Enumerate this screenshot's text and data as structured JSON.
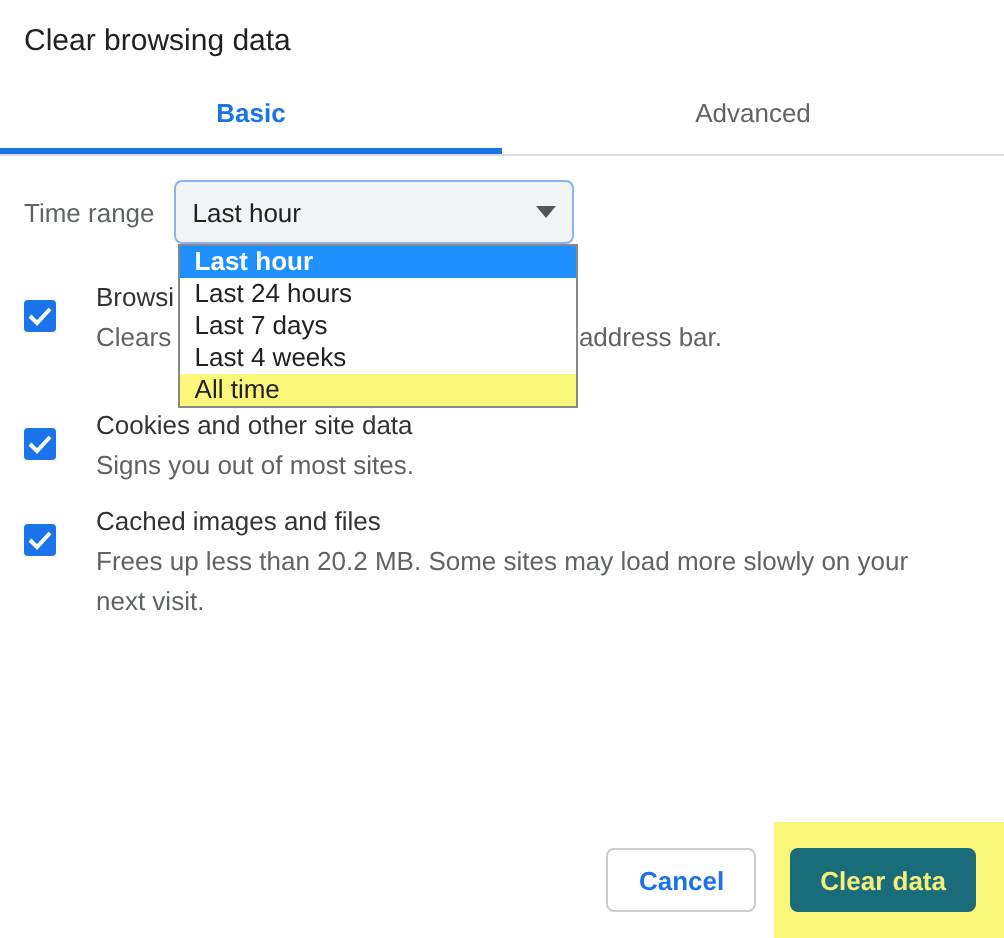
{
  "dialog": {
    "title": "Clear browsing data"
  },
  "tabs": [
    {
      "label": "Basic",
      "selected": true
    },
    {
      "label": "Advanced",
      "selected": false
    }
  ],
  "time_range": {
    "label": "Time range",
    "value": "Last hour",
    "expanded": true,
    "options": [
      {
        "label": "Last hour",
        "selected": true,
        "highlighted": false
      },
      {
        "label": "Last 24 hours",
        "selected": false,
        "highlighted": false
      },
      {
        "label": "Last 7 days",
        "selected": false,
        "highlighted": false
      },
      {
        "label": "Last 4 weeks",
        "selected": false,
        "highlighted": false
      },
      {
        "label": "All time",
        "selected": false,
        "highlighted": true
      }
    ]
  },
  "items": [
    {
      "title": "Browsi",
      "description": [
        "Clears",
        "address bar."
      ],
      "checked": true
    },
    {
      "title": "Cookies and other site data",
      "description": [
        "Signs you out of most sites."
      ],
      "checked": true
    },
    {
      "title": "Cached images and files",
      "description": [
        "Frees up less than 20.2 MB. Some sites may load more slowly on your next visit."
      ],
      "checked": true
    }
  ],
  "buttons": [
    {
      "label": "Cancel",
      "kind": "secondary",
      "highlighted": false
    },
    {
      "label": "Clear data",
      "kind": "primary",
      "highlighted": true
    }
  ]
}
